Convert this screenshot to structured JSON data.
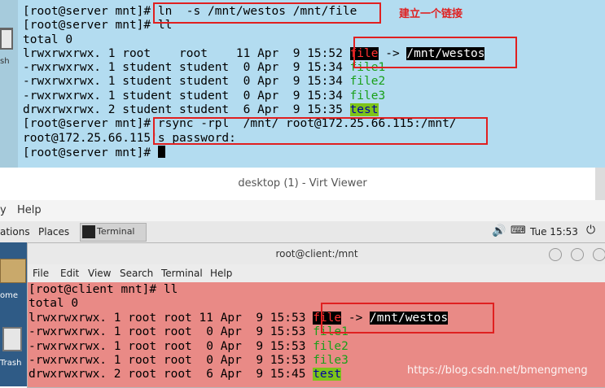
{
  "top_terminal": {
    "lines": [
      {
        "prompt": "[root@server mnt]# ",
        "cmd": "ln  -s /mnt/westos /mnt/file"
      },
      {
        "prompt": "[root@server mnt]# ",
        "cmd": "ll"
      },
      {
        "text": "total 0"
      },
      {
        "meta": "lrwxrwxrwx. 1 root    root    11 Apr  9 15:52 ",
        "name": "file",
        "arrow": " -> ",
        "target": "/mnt/westos"
      },
      {
        "meta": "-rwxrwxrwx. 1 student student  0 Apr  9 15:34 ",
        "name": "file1"
      },
      {
        "meta": "-rwxrwxrwx. 1 student student  0 Apr  9 15:34 ",
        "name": "file2"
      },
      {
        "meta": "-rwxrwxrwx. 1 student student  0 Apr  9 15:34 ",
        "name": "file3"
      },
      {
        "meta": "drwxrwxrwx. 2 student student  6 Apr  9 15:35 ",
        "name": "test"
      },
      {
        "prompt": "[root@server mnt]# ",
        "cmd": "rsync -rpl  /mnt/ root@172.25.66.115:/mnt/"
      },
      {
        "text": "root@172.25.66.115's password:"
      },
      {
        "prompt": "[root@server mnt]# ",
        "cmd": ""
      }
    ],
    "annotation": "建立一个链接",
    "trash_label": "sh"
  },
  "viewer": {
    "title": "desktop (1) - Virt Viewer",
    "menu": [
      "y",
      "Help"
    ]
  },
  "panel": {
    "applications": "ations",
    "places": "Places",
    "terminal": "Terminal",
    "clock": "Tue 15:53"
  },
  "desktop": {
    "home_label": "ome",
    "trash_label": "Trash"
  },
  "client_window": {
    "title": "root@client:/mnt",
    "menu": [
      "File",
      "Edit",
      "View",
      "Search",
      "Terminal",
      "Help"
    ],
    "lines": [
      {
        "prompt": "[root@client mnt]# ",
        "cmd": "ll"
      },
      {
        "text": "total 0"
      },
      {
        "meta": "lrwxrwxrwx. 1 root root 11 Apr  9 15:53 ",
        "name": "file",
        "arrow": " -> ",
        "target": "/mnt/westos"
      },
      {
        "meta": "-rwxrwxrwx. 1 root root  0 Apr  9 15:53 ",
        "name": "file1"
      },
      {
        "meta": "-rwxrwxrwx. 1 root root  0 Apr  9 15:53 ",
        "name": "file2"
      },
      {
        "meta": "-rwxrwxrwx. 1 root root  0 Apr  9 15:53 ",
        "name": "file3"
      },
      {
        "meta": "drwxrwxrwx. 2 root root  6 Apr  9 15:45 ",
        "name": "test"
      }
    ]
  },
  "watermark": "https://blog.csdn.net/bmengmeng"
}
